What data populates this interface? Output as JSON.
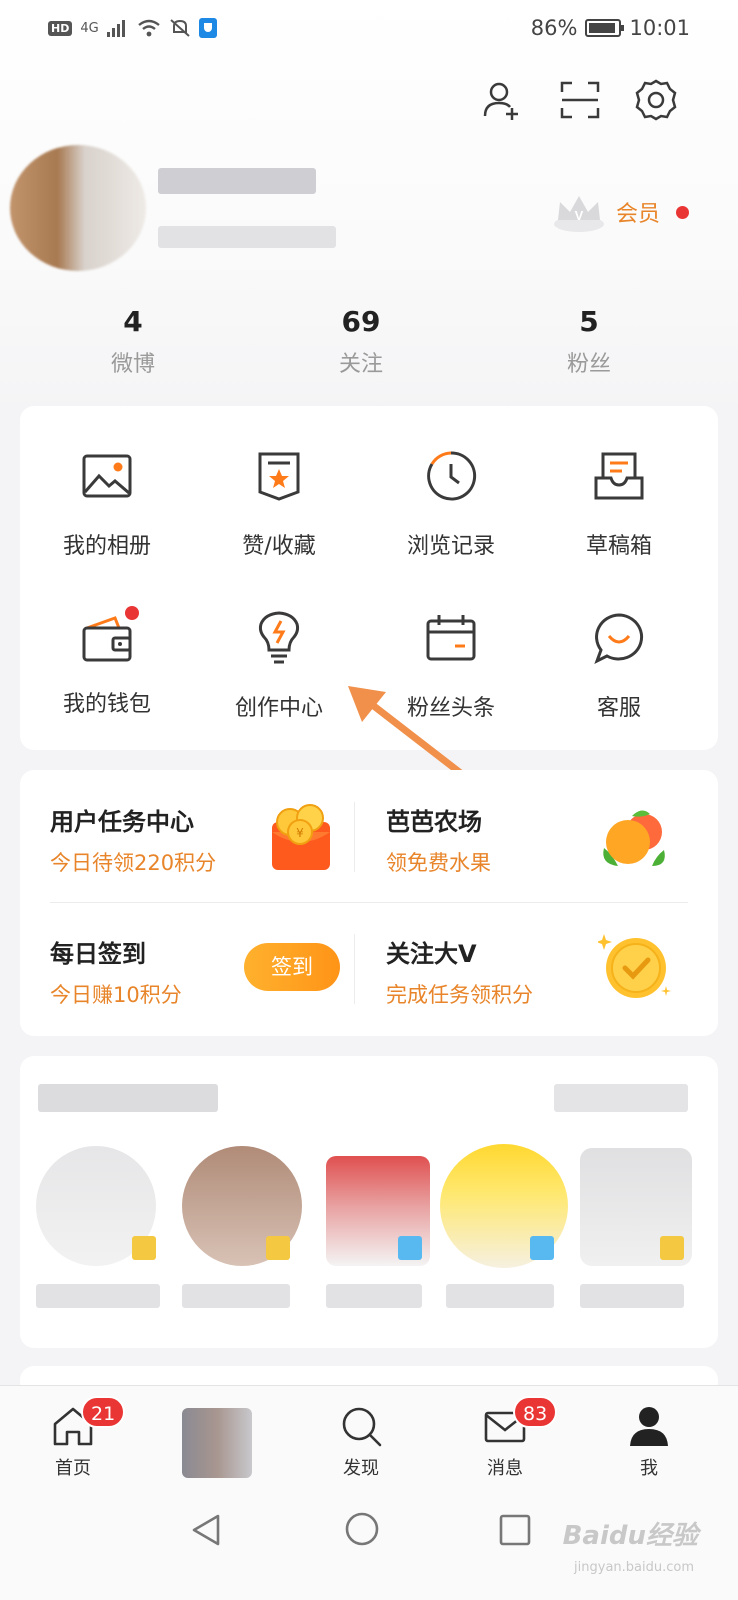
{
  "status_bar": {
    "hd": "HD",
    "network": "4G",
    "battery": "86%",
    "time": "10:01"
  },
  "profile": {
    "vip_label": "会员"
  },
  "stats": [
    {
      "value": "4",
      "label": "微博"
    },
    {
      "value": "69",
      "label": "关注"
    },
    {
      "value": "5",
      "label": "粉丝"
    }
  ],
  "grid": [
    {
      "label": "我的相册",
      "icon": "photo-album-icon"
    },
    {
      "label": "赞/收藏",
      "icon": "favorites-icon"
    },
    {
      "label": "浏览记录",
      "icon": "history-icon"
    },
    {
      "label": "草稿箱",
      "icon": "drafts-icon"
    },
    {
      "label": "我的钱包",
      "icon": "wallet-icon"
    },
    {
      "label": "创作中心",
      "icon": "creator-center-icon"
    },
    {
      "label": "粉丝头条",
      "icon": "fans-headline-icon"
    },
    {
      "label": "客服",
      "icon": "customer-service-icon"
    }
  ],
  "tasks": {
    "task_center": {
      "title": "用户任务中心",
      "sub": "今日待领220积分"
    },
    "farm": {
      "title": "芭芭农场",
      "sub": "领免费水果"
    },
    "checkin": {
      "title": "每日签到",
      "sub": "今日赚10积分",
      "button": "签到"
    },
    "follow_v": {
      "title": "关注大V",
      "sub": "完成任务领积分"
    }
  },
  "bottom_nav": [
    {
      "label": "首页",
      "badge": "21",
      "icon": "home-icon"
    },
    {
      "label": "",
      "badge": "",
      "icon": "avatar-icon"
    },
    {
      "label": "发现",
      "badge": "",
      "icon": "search-icon"
    },
    {
      "label": "消息",
      "badge": "83",
      "icon": "mail-icon"
    },
    {
      "label": "我",
      "badge": "",
      "icon": "profile-icon"
    }
  ],
  "watermark": {
    "text": "Baidu经验",
    "sub": "jingyan.baidu.com"
  },
  "colors": {
    "accent": "#e8852a",
    "badge": "#ea3535",
    "icon_dark": "#3a3a3a"
  }
}
